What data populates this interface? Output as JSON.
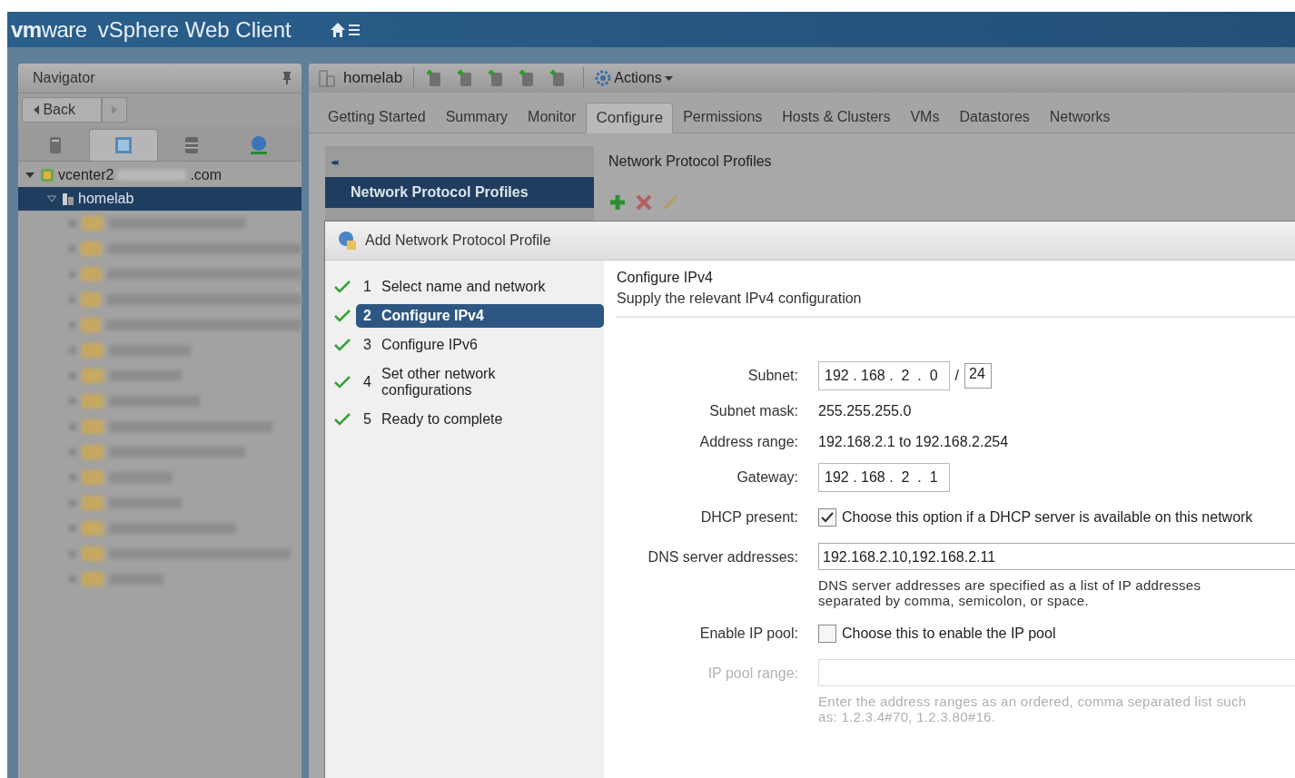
{
  "header": {
    "logo_bold": "vm",
    "logo_light": "ware",
    "product": "vSphere Web Client"
  },
  "navigator": {
    "title": "Navigator",
    "back": "Back",
    "tabs": [
      {
        "kind": "host",
        "selected": false
      },
      {
        "kind": "vm",
        "selected": true
      },
      {
        "kind": "storage",
        "selected": false
      },
      {
        "kind": "network",
        "selected": false
      }
    ],
    "tree": [
      {
        "label_start": "vcenter2",
        "label_end": ".com",
        "expanded": true,
        "selected": false,
        "children": [
          {
            "label": "homelab",
            "expanded": true,
            "selected": true
          }
        ]
      }
    ]
  },
  "toolbar": {
    "object": "homelab",
    "actions": "Actions"
  },
  "tabs": [
    {
      "label": "Getting Started",
      "selected": false
    },
    {
      "label": "Summary",
      "selected": false
    },
    {
      "label": "Monitor",
      "selected": false
    },
    {
      "label": "Configure",
      "selected": true
    },
    {
      "label": "Permissions",
      "selected": false
    },
    {
      "label": "Hosts & Clusters",
      "selected": false
    },
    {
      "label": "VMs",
      "selected": false
    },
    {
      "label": "Datastores",
      "selected": false
    },
    {
      "label": "Networks",
      "selected": false
    }
  ],
  "side_menu": {
    "collapse": "◂◂",
    "items": [
      {
        "label": "Network Protocol Profiles",
        "selected": true
      }
    ]
  },
  "panel": {
    "title": "Network Protocol Profiles"
  },
  "dialog": {
    "title": "Add Network Protocol Profile",
    "steps": [
      {
        "number": "1",
        "label": "Select name and network",
        "done": true,
        "selected": false
      },
      {
        "number": "2",
        "label": "Configure IPv4",
        "done": true,
        "selected": true
      },
      {
        "number": "3",
        "label": "Configure IPv6",
        "done": true,
        "selected": false
      },
      {
        "number": "4",
        "label": "Set other network configurations",
        "done": true,
        "selected": false
      },
      {
        "number": "5",
        "label": "Ready to complete",
        "done": true,
        "selected": false
      }
    ],
    "heading": "Configure IPv4",
    "subheading": "Supply the relevant IPv4 configuration",
    "fields": [
      {
        "kind": "ip",
        "label": "Subnet:",
        "value": "192 . 168 .  2  .  0",
        "slash": "/",
        "prefix": "24"
      },
      {
        "kind": "text",
        "label": "Subnet mask:",
        "value": "255.255.255.0"
      },
      {
        "kind": "text",
        "label": "Address range:",
        "value": "192.168.2.1 to 192.168.2.254"
      },
      {
        "kind": "ip",
        "label": "Gateway:",
        "value": "192 . 168 .  2  .  1"
      },
      {
        "kind": "checkbox",
        "label": "DHCP present:",
        "checked": true,
        "text": "Choose this option if a DHCP server is available on this network"
      },
      {
        "kind": "input",
        "label": "DNS server addresses:",
        "value": "192.168.2.10,192.168.2.11",
        "disabled": false,
        "note": "DNS server addresses are specified as a list of IP addresses separated by comma, semicolon, or space."
      },
      {
        "kind": "checkbox",
        "label": "Enable IP pool:",
        "checked": false,
        "text": "Choose this to enable the IP pool"
      },
      {
        "kind": "input",
        "label": "IP pool range:",
        "disabled": true,
        "note": "Enter the address ranges as an ordered, comma separated list such as: 1.2.3.4#70, 1.2.3.80#16."
      }
    ]
  }
}
